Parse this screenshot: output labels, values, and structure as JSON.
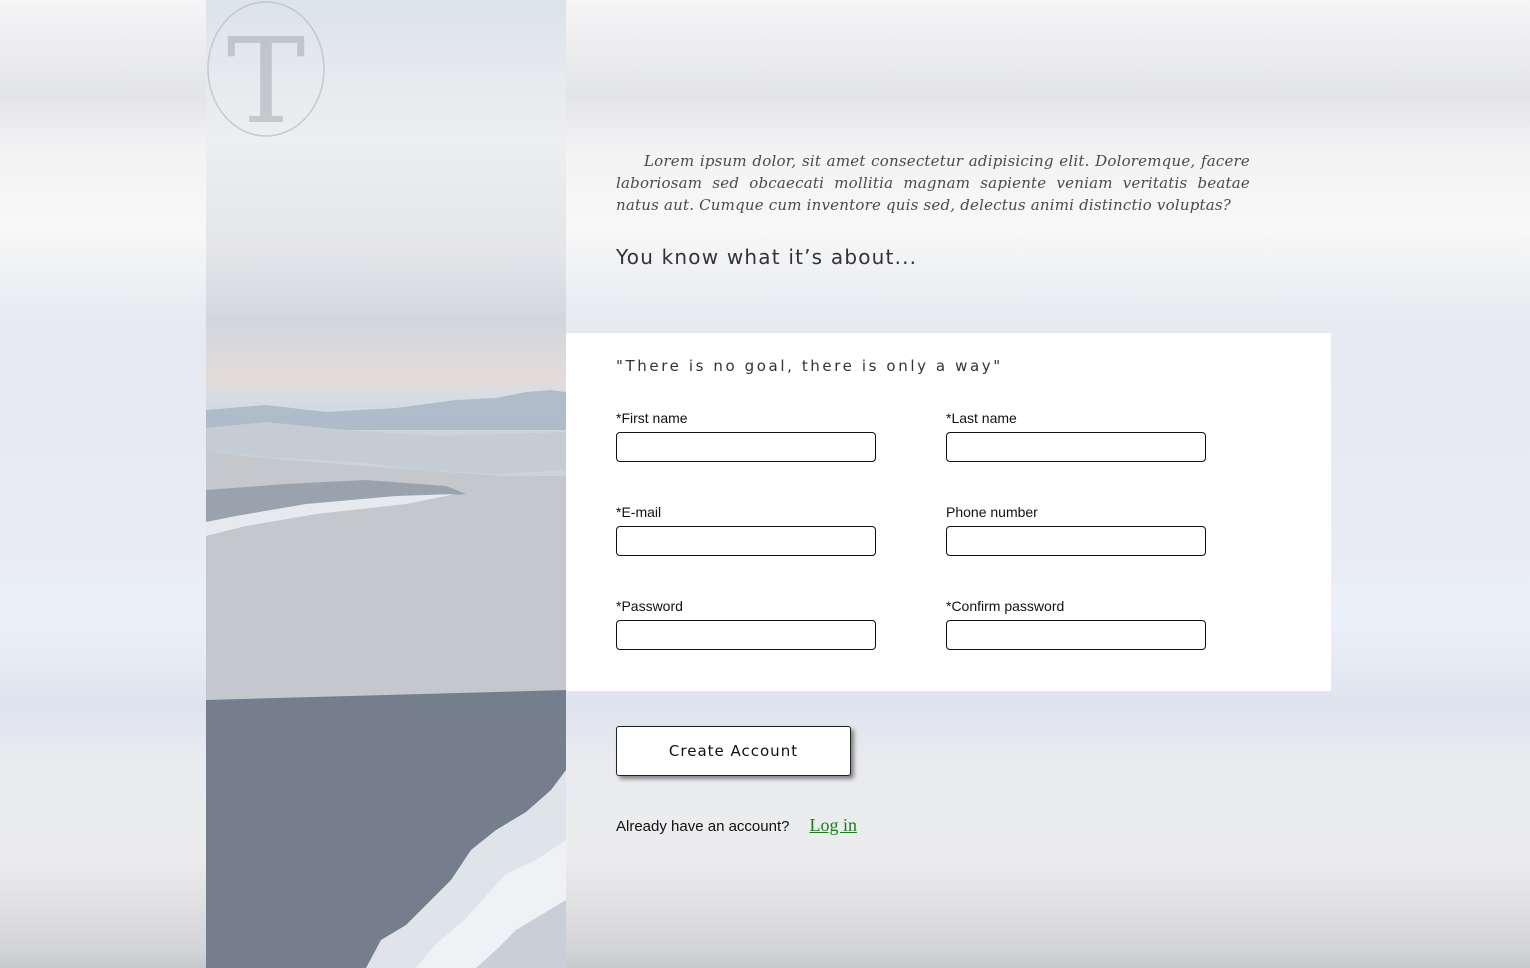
{
  "intro": {
    "paragraph": "Lorem ipsum dolor, sit amet consectetur adipisicing elit. Doloremque, facere laboriosam sed obcaecati mollitia magnam sapiente veniam veritatis beatae natus aut. Cumque cum inventore quis sed, delectus animi distinctio voluptas?",
    "tagline": "You know what it’s about..."
  },
  "logo": {
    "letter": "T"
  },
  "form": {
    "quote": "\"There is no goal, there is only a way\"",
    "fields": {
      "first_name": {
        "label": "*First name",
        "value": ""
      },
      "last_name": {
        "label": "*Last name",
        "value": ""
      },
      "email": {
        "label": "*E-mail",
        "value": ""
      },
      "phone": {
        "label": "Phone number",
        "value": ""
      },
      "password": {
        "label": "*Password",
        "value": ""
      },
      "confirm_password": {
        "label": "*Confirm password",
        "value": ""
      }
    },
    "submit_label": "Create Account"
  },
  "login": {
    "prompt": "Already have an account?",
    "link_label": "Log in"
  },
  "colors": {
    "link": "#1a7d1a",
    "card": "#ffffff"
  }
}
